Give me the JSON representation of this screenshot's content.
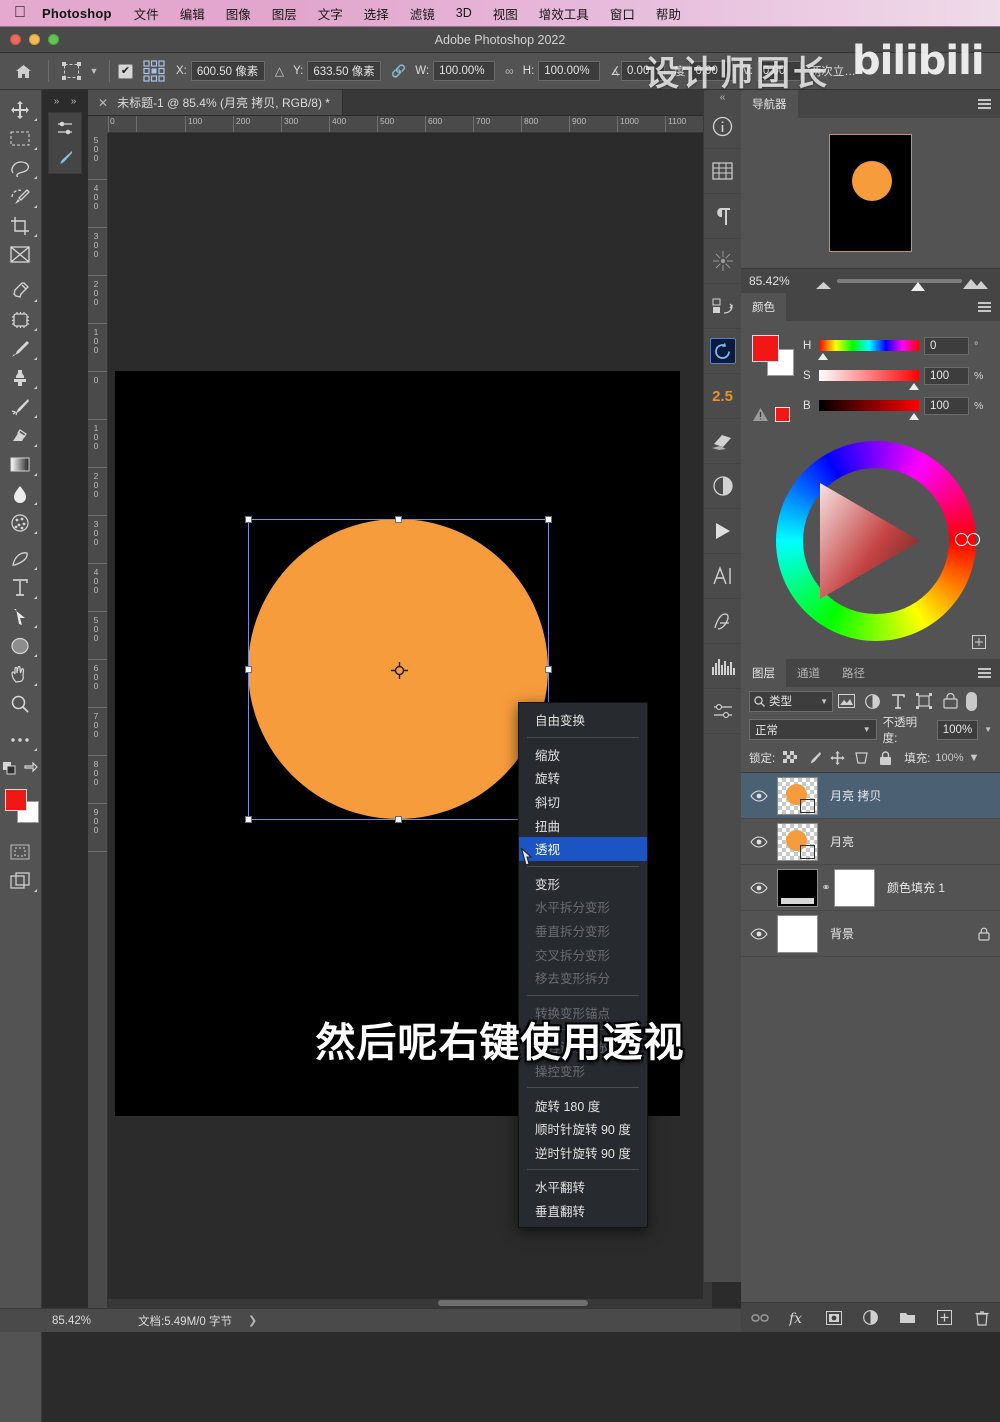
{
  "macbar": {
    "apple_icon": "apple-logo-icon",
    "app_name": "Photoshop",
    "menus": [
      "文件",
      "编辑",
      "图像",
      "图层",
      "文字",
      "选择",
      "滤镜",
      "3D",
      "视图",
      "增效工具",
      "窗口",
      "帮助"
    ]
  },
  "window": {
    "title": "Adobe Photoshop 2022"
  },
  "options_bar": {
    "home_icon": "home-icon",
    "tool_icon": "free-transform-icon",
    "chevron_icon": "chevron-down-icon",
    "checkbox_checked": "✔",
    "reference_point_icon": "reference-point-grid-icon",
    "x_label": "X:",
    "x_value": "600.50 像素",
    "delta_icon": "delta-icon",
    "y_label": "Y:",
    "y_value": "633.50 像素",
    "link_icon": "link-chain-icon",
    "w_label": "W:",
    "w_value": "100.00%",
    "h_label": "H:",
    "h_value": "100.00%",
    "angle_icon": "angle-icon",
    "angle_value": "0.00",
    "angle_unit": "度",
    "shear_h_value": "0.00",
    "shear_v_label": "V:",
    "shear_v_value": "0.00",
    "tail_text": "两次立…"
  },
  "document_tab": {
    "close_icon": "close-icon",
    "label": "未标题-1 @ 85.4% (月亮 拷贝, RGB/8) *"
  },
  "tools": [
    {
      "name": "move-tool",
      "icon": "move-icon"
    },
    {
      "name": "rectangular-marquee-tool",
      "icon": "marquee-rect-icon"
    },
    {
      "name": "lasso-tool",
      "icon": "lasso-icon"
    },
    {
      "name": "quick-selection-tool",
      "icon": "quick-select-icon"
    },
    {
      "name": "crop-tool",
      "icon": "crop-icon"
    },
    {
      "name": "frame-tool",
      "icon": "frame-icon"
    },
    {
      "name": "eyedropper-tool",
      "icon": "eyedropper-icon"
    },
    {
      "name": "spot-healing-tool",
      "icon": "healing-patch-icon"
    },
    {
      "name": "brush-tool",
      "icon": "brush-icon"
    },
    {
      "name": "clone-stamp-tool",
      "icon": "stamp-icon"
    },
    {
      "name": "history-brush-tool",
      "icon": "history-brush-icon"
    },
    {
      "name": "eraser-tool",
      "icon": "eraser-icon"
    },
    {
      "name": "gradient-tool",
      "icon": "gradient-icon"
    },
    {
      "name": "blur-tool",
      "icon": "blur-drop-icon"
    },
    {
      "name": "dodge-tool",
      "icon": "dodge-sponge-icon"
    },
    {
      "name": "pen-tool",
      "icon": "pen-icon"
    },
    {
      "name": "type-tool",
      "icon": "type-t-icon"
    },
    {
      "name": "path-selection-tool",
      "icon": "arrow-select-icon"
    },
    {
      "name": "ellipse-shape-tool",
      "icon": "ellipse-icon"
    },
    {
      "name": "hand-tool",
      "icon": "hand-icon"
    },
    {
      "name": "zoom-tool",
      "icon": "magnifier-icon"
    },
    {
      "name": "more-tools",
      "icon": "ellipsis-icon"
    }
  ],
  "tool_footer": {
    "swap_icon": "swap-colors-icon",
    "default_icon": "default-colors-icon",
    "foreground_color": "#f21616",
    "background_color": "#ffffff",
    "quickmask_icon": "quick-mask-icon",
    "screenmode_icon": "screen-mode-icon"
  },
  "rulers": {
    "horizontal": [
      "0",
      "100",
      "200",
      "300",
      "400",
      "500",
      "600",
      "700",
      "800",
      "900",
      "1000",
      "1100"
    ],
    "vertical": [
      "500",
      "400",
      "300",
      "200",
      "100",
      "0",
      "100",
      "200",
      "300",
      "400",
      "500",
      "600",
      "700",
      "800",
      "900"
    ]
  },
  "canvas": {
    "artboard_bg": "#000000",
    "moon_color": "#f79c3c",
    "transform_box_color": "#7b8fd6",
    "pivot_icon": "transform-pivot-icon"
  },
  "subtitle": "然后呢右键使用透视",
  "context_menu": {
    "cursor_icon": "mouse-cursor-icon",
    "items": [
      {
        "label": "自由变换",
        "state": "normal"
      },
      {
        "label": "__divider__",
        "state": "divider"
      },
      {
        "label": "缩放",
        "state": "normal"
      },
      {
        "label": "旋转",
        "state": "normal"
      },
      {
        "label": "斜切",
        "state": "normal"
      },
      {
        "label": "扭曲",
        "state": "normal"
      },
      {
        "label": "透视",
        "state": "selected"
      },
      {
        "label": "__divider__",
        "state": "divider"
      },
      {
        "label": "变形",
        "state": "normal"
      },
      {
        "label": "水平拆分变形",
        "state": "disabled"
      },
      {
        "label": "垂直拆分变形",
        "state": "disabled"
      },
      {
        "label": "交叉拆分变形",
        "state": "disabled"
      },
      {
        "label": "移去变形拆分",
        "state": "disabled"
      },
      {
        "label": "__divider__",
        "state": "divider"
      },
      {
        "label": "转换变形锚点",
        "state": "disabled"
      },
      {
        "label": "__divider__",
        "state": "divider"
      },
      {
        "label": "内容识别缩放",
        "state": "disabled"
      },
      {
        "label": "操控变形",
        "state": "disabled"
      },
      {
        "label": "__divider__",
        "state": "divider"
      },
      {
        "label": "旋转 180 度",
        "state": "normal"
      },
      {
        "label": "顺时针旋转 90 度",
        "state": "normal"
      },
      {
        "label": "逆时针旋转 90 度",
        "state": "normal"
      },
      {
        "label": "__divider__",
        "state": "divider"
      },
      {
        "label": "水平翻转",
        "state": "normal"
      },
      {
        "label": "垂直翻转",
        "state": "normal"
      }
    ]
  },
  "dock": [
    {
      "name": "dock-info",
      "icon": "info-circle-icon"
    },
    {
      "name": "dock-properties",
      "icon": "grid-table-icon"
    },
    {
      "name": "dock-paragraph",
      "icon": "paragraph-pilcrow-icon"
    },
    {
      "name": "dock-brush-settings",
      "icon": "brush-burst-icon"
    },
    {
      "name": "dock-history",
      "icon": "history-undo-icon"
    },
    {
      "name": "dock-rotate-view",
      "icon": "rotate-view-icon",
      "highlight": true
    },
    {
      "name": "dock-version-25",
      "icon": "badge-2-5",
      "label": "2.5"
    },
    {
      "name": "dock-3d",
      "icon": "3d-plane-icon"
    },
    {
      "name": "dock-adjustments",
      "icon": "half-circle-icon"
    },
    {
      "name": "dock-actions",
      "icon": "play-triangle-icon"
    },
    {
      "name": "dock-character",
      "icon": "character-a-icon"
    },
    {
      "name": "dock-glyphs",
      "icon": "glyph-script-a-icon"
    },
    {
      "name": "dock-histogram",
      "icon": "histogram-icon"
    },
    {
      "name": "dock-settings",
      "icon": "sliders-icon"
    }
  ],
  "navigator": {
    "tab_label": "导航器",
    "menu_icon": "panel-menu-icon",
    "zoom_value": "85.42%",
    "zoom_out_icon": "small-mountain-icon",
    "zoom_in_icon": "large-mountain-icon",
    "thumb_border_color": "#c78b7e"
  },
  "color_panel": {
    "tab_label": "颜色",
    "menu_icon": "panel-menu-icon",
    "fg_swatch": "#f21616",
    "bg_swatch": "#ffffff",
    "out_of_gamut_icon": "gamut-warning-icon",
    "rows": [
      {
        "key": "H",
        "value": "0",
        "unit": "°"
      },
      {
        "key": "S",
        "value": "100",
        "unit": "%"
      },
      {
        "key": "B",
        "value": "100",
        "unit": "%"
      }
    ],
    "wheel_icon": "color-wheel",
    "wheel_settings_icon": "wheel-options-icon"
  },
  "layers_panel": {
    "tabs": [
      {
        "label": "图层",
        "active": true
      },
      {
        "label": "通道",
        "active": false
      },
      {
        "label": "路径",
        "active": false
      }
    ],
    "menu_icon": "panel-menu-icon",
    "filter": {
      "search_icon": "search-icon",
      "type_label": "类型",
      "chevron_icon": "chevron-down-icon",
      "icons": [
        {
          "name": "filter-pixel-layers",
          "icon": "image-icon"
        },
        {
          "name": "filter-adjustment-layers",
          "icon": "half-circle-icon"
        },
        {
          "name": "filter-type-layers",
          "icon": "type-t-icon"
        },
        {
          "name": "filter-shape-layers",
          "icon": "shape-icon"
        },
        {
          "name": "filter-smart-objects",
          "icon": "smart-object-icon"
        }
      ],
      "toggle": "filter-enable-toggle"
    },
    "blend_mode": "正常",
    "opacity_label": "不透明度:",
    "opacity_value": "100%",
    "lock_label": "锁定:",
    "lock_icons": [
      {
        "name": "lock-transparent-pixels",
        "icon": "checkerboard-icon"
      },
      {
        "name": "lock-image-pixels",
        "icon": "brush-icon"
      },
      {
        "name": "lock-position",
        "icon": "move-cross-icon"
      },
      {
        "name": "lock-artboard-nesting",
        "icon": "artboard-icon"
      },
      {
        "name": "lock-all",
        "icon": "lock-icon"
      }
    ],
    "fill_label": "填充:",
    "fill_value": "100%",
    "layers": [
      {
        "name": "月亮 拷贝",
        "selected": true,
        "thumb": "moon-transparent",
        "visible": true,
        "locked": false
      },
      {
        "name": "月亮",
        "selected": false,
        "thumb": "moon-transparent",
        "visible": true,
        "locked": false
      },
      {
        "name": "颜色填充 1",
        "selected": false,
        "thumb": "fill-with-mask",
        "visible": true,
        "locked": false
      },
      {
        "name": "背景",
        "selected": false,
        "thumb": "white",
        "visible": true,
        "locked": true
      }
    ],
    "footer_icons": [
      {
        "name": "link-layers-button",
        "icon": "link-chain-icon"
      },
      {
        "name": "layer-style-button",
        "icon": "fx-icon"
      },
      {
        "name": "add-mask-button",
        "icon": "mask-icon"
      },
      {
        "name": "new-adjustment-layer-button",
        "icon": "half-circle-icon"
      },
      {
        "name": "new-group-button",
        "icon": "folder-icon"
      },
      {
        "name": "new-layer-button",
        "icon": "plus-square-icon"
      },
      {
        "name": "delete-layer-button",
        "icon": "trash-icon"
      }
    ]
  },
  "status_bar": {
    "zoom": "85.42%",
    "doc_info": "文档:5.49M/0 字节",
    "arrow_icon": "chevron-right-icon"
  },
  "watermark": {
    "chinese": "设计师团长",
    "brand": "bilibili"
  },
  "colors": {
    "accent_orange": "#f79c3c",
    "menu_highlight": "#1c54c4",
    "layer_selected": "#4c6074",
    "panel_bg": "#535353",
    "macbar_pink": "#e5a8cf"
  }
}
